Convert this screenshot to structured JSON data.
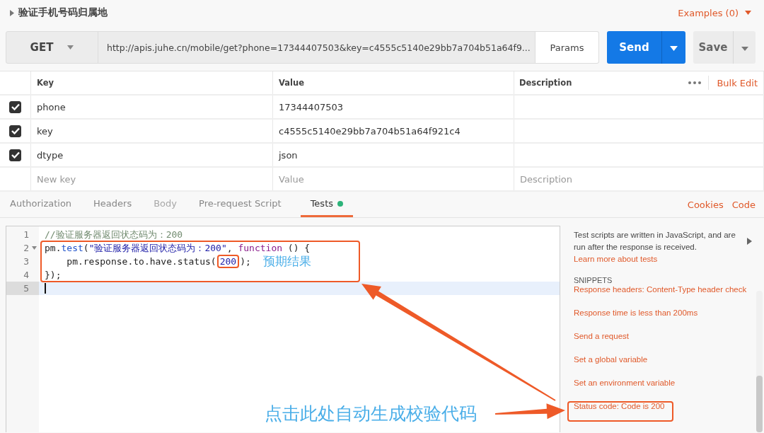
{
  "request": {
    "title": "验证手机号码归属地",
    "examples": "Examples (0)",
    "method": "GET",
    "url": "http://apis.juhe.cn/mobile/get?phone=17344407503&key=c4555c5140e29bb7a704b51a64f9...",
    "params_button": "Params",
    "send_button": "Send",
    "save_button": "Save"
  },
  "params_table": {
    "columns": [
      "Key",
      "Value",
      "Description"
    ],
    "bulk_edit": "Bulk Edit",
    "rows": [
      {
        "checked": true,
        "key": "phone",
        "value": "17344407503"
      },
      {
        "checked": true,
        "key": "key",
        "value": "c4555c5140e29bb7a704b51a64f921c4"
      },
      {
        "checked": true,
        "key": "dtype",
        "value": "json"
      }
    ],
    "new_row": {
      "key_placeholder": "New key",
      "value_placeholder": "Value",
      "description_placeholder": "Description"
    }
  },
  "tabs": [
    {
      "label": "Authorization",
      "selected": false,
      "disabled": false,
      "dot": false
    },
    {
      "label": "Headers",
      "selected": false,
      "disabled": false,
      "dot": false
    },
    {
      "label": "Body",
      "selected": false,
      "disabled": true,
      "dot": false
    },
    {
      "label": "Pre-request Script",
      "selected": false,
      "disabled": false,
      "dot": false
    },
    {
      "label": "Tests",
      "selected": true,
      "disabled": false,
      "dot": true
    }
  ],
  "tab_links": [
    "Cookies",
    "Code"
  ],
  "editor": {
    "lines": [
      {
        "number": "1",
        "active": false,
        "fold": false,
        "tokens": [
          {
            "kind": "comment",
            "text": "//验证服务器返回状态码为：200"
          }
        ]
      },
      {
        "number": "2",
        "active": false,
        "fold": true,
        "tokens": [
          {
            "kind": "plain",
            "text": "pm."
          },
          {
            "kind": "func",
            "text": "test"
          },
          {
            "kind": "plain",
            "text": "("
          },
          {
            "kind": "string",
            "text": "\"验证服务器返回状态码为：200\""
          },
          {
            "kind": "plain",
            "text": ", "
          },
          {
            "kind": "keyword",
            "text": "function"
          },
          {
            "kind": "plain",
            "text": " () {"
          }
        ]
      },
      {
        "number": "3",
        "active": false,
        "fold": false,
        "tokens": [
          {
            "kind": "plain",
            "text": "    pm.response.to.have.status("
          },
          {
            "kind": "number",
            "text": "200",
            "boxed": true
          },
          {
            "kind": "plain",
            "text": ");"
          }
        ]
      },
      {
        "number": "4",
        "active": false,
        "fold": false,
        "tokens": [
          {
            "kind": "plain",
            "text": "});"
          }
        ]
      },
      {
        "number": "5",
        "active": true,
        "fold": false
      }
    ]
  },
  "help_panel": {
    "description": "Test scripts are written in JavaScript, and are run after the response is received.",
    "learn_more": "Learn more about tests",
    "snippets_heading": "SNIPPETS",
    "snippets": [
      "Response headers: Content-Type header check",
      "Response time is less than 200ms",
      "Send a request",
      "Set a global variable",
      "Set an environment variable",
      "Status code: Code is 200"
    ]
  },
  "annotations": [
    {
      "kind": "box"
    },
    {
      "kind": "text",
      "text": "预期结果"
    },
    {
      "kind": "arrow"
    },
    {
      "kind": "text",
      "text": "点击此处自动生成校验代码"
    },
    {
      "kind": "arrow"
    },
    {
      "kind": "box"
    }
  ]
}
